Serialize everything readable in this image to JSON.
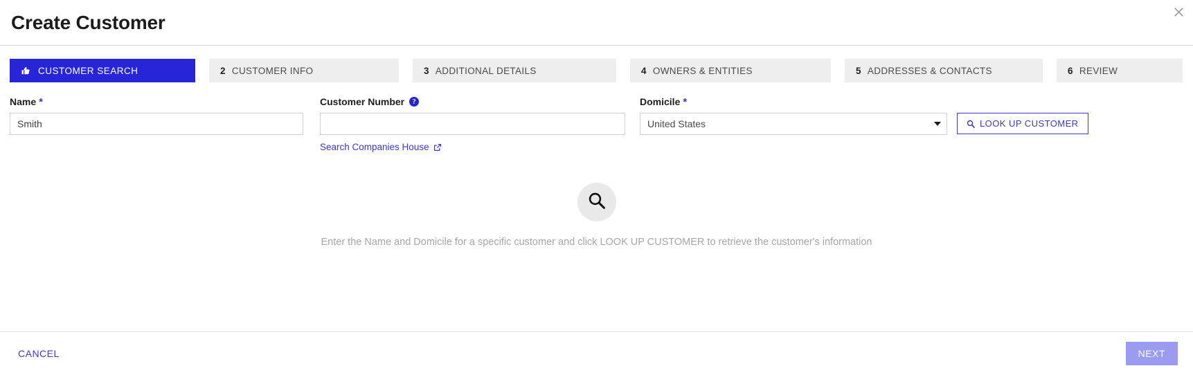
{
  "header": {
    "title": "Create Customer",
    "close_icon": "close-icon"
  },
  "stepper": {
    "steps": [
      {
        "num": "",
        "label": "CUSTOMER SEARCH",
        "icon": "thumbs-up-icon",
        "active": true
      },
      {
        "num": "2",
        "label": "CUSTOMER INFO",
        "icon": "",
        "active": false
      },
      {
        "num": "3",
        "label": "ADDITIONAL DETAILS",
        "icon": "",
        "active": false
      },
      {
        "num": "4",
        "label": "OWNERS & ENTITIES",
        "icon": "",
        "active": false
      },
      {
        "num": "5",
        "label": "ADDRESSES & CONTACTS",
        "icon": "",
        "active": false
      },
      {
        "num": "6",
        "label": "REVIEW",
        "icon": "",
        "active": false
      }
    ]
  },
  "form": {
    "name": {
      "label": "Name",
      "required_marker": "*",
      "value": "Smith",
      "placeholder": ""
    },
    "customer_number": {
      "label": "Customer Number",
      "help_icon": "?",
      "value": "",
      "placeholder": "",
      "link_text": "Search Companies House",
      "link_icon": "external-link-icon"
    },
    "domicile": {
      "label": "Domicile",
      "required_marker": "*",
      "selected": "United States",
      "options": [
        "United States"
      ]
    },
    "lookup_button": {
      "label": "LOOK UP CUSTOMER",
      "icon": "search-icon"
    }
  },
  "empty_state": {
    "icon": "search-icon",
    "message": "Enter the Name and Domicile for a specific customer and click LOOK UP CUSTOMER to retrieve the customer's information"
  },
  "footer": {
    "cancel_label": "CANCEL",
    "next_label": "NEXT"
  },
  "colors": {
    "accent": "#2626d8",
    "link": "#3a37c9",
    "next_disabled": "#9b9bf2",
    "tab_inactive": "#eeeeee"
  }
}
